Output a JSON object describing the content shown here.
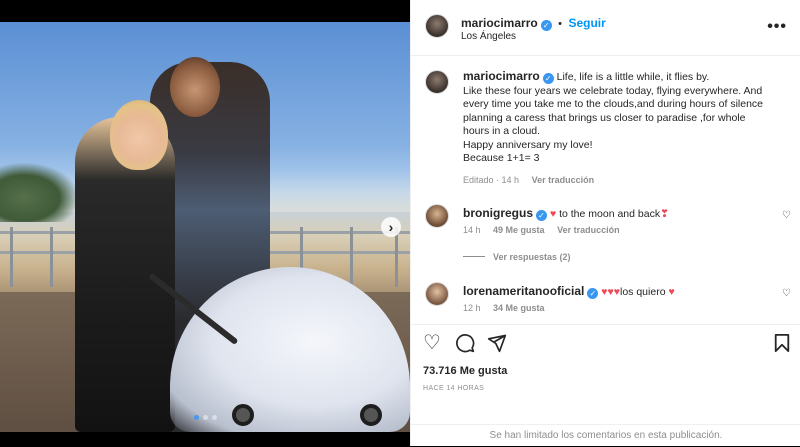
{
  "post": {
    "username": "mariocimarro",
    "follow_label": "Seguir",
    "location": "Los Ángeles",
    "more_label": "•••"
  },
  "caption": {
    "username": "mariocimarro",
    "lines": [
      "Life, life is a little while, it flies by.",
      "Like these four years we celebrate today, flying everywhere. And",
      "every time you take me to the clouds,and during hours of silence",
      "planning a caress that brings us closer to paradise ,for whole",
      "hours in a cloud.",
      "Happy anniversary my love!",
      "Because 1+1= 3"
    ],
    "edited_label": "Editado · 14 h",
    "translate_label": "Ver traducción"
  },
  "comments": [
    {
      "username": "bronigregus",
      "text": "to the moon and back",
      "time": "14 h",
      "likes": "49 Me gusta",
      "translate_label": "Ver traducción",
      "replies_label": "Ver respuestas (2)"
    },
    {
      "username": "lorenameritanooficial",
      "text": "los quiero",
      "time": "12 h",
      "likes": "34 Me gusta"
    }
  ],
  "actions": {
    "likes_count": "73.716 Me gusta",
    "time_ago": "HACE 14 HORAS",
    "comments_limited": "Se han limitado los comentarios en esta publicación."
  },
  "icons": {
    "heart": "heart-icon",
    "comment": "comment-icon",
    "share": "share-icon",
    "save": "bookmark-icon",
    "verified": "verified-badge-icon",
    "next": "chevron-right-icon"
  },
  "colors": {
    "accent": "#0095f6",
    "verified": "#3897f0",
    "red_heart": "#ed4956",
    "muted": "#8e8e8e"
  }
}
